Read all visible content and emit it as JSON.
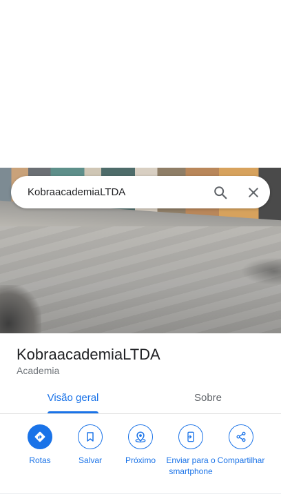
{
  "search": {
    "query": "KobraacademiaLTDA"
  },
  "place": {
    "name": "KobraacademiaLTDA",
    "category": "Academia"
  },
  "tabs": [
    {
      "label": "Visão geral",
      "active": true
    },
    {
      "label": "Sobre",
      "active": false
    }
  ],
  "actions": [
    {
      "label": "Rotas",
      "icon": "directions-icon"
    },
    {
      "label": "Salvar",
      "icon": "bookmark-icon"
    },
    {
      "label": "Próximo",
      "icon": "nearby-icon"
    },
    {
      "label": "Enviar para o smartphone",
      "icon": "send-to-phone-icon"
    },
    {
      "label": "Compartilhar",
      "icon": "share-icon"
    }
  ],
  "colors": {
    "accent": "#1a73e8",
    "text_primary": "#202124",
    "text_secondary": "#70757a"
  }
}
